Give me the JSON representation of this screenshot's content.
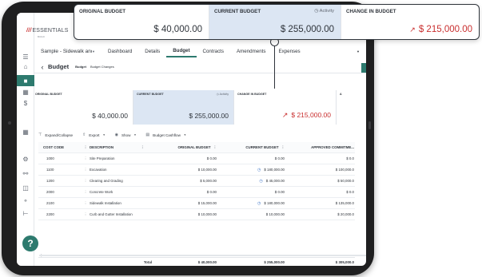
{
  "app": {
    "logo_text": "ESSENTIALS",
    "logo_sub": "BUILD"
  },
  "sidebar": {
    "icons": [
      "menu-icon",
      "home-icon",
      "dollar-active-icon",
      "grid-icon",
      "dollar-icon",
      "building-icon",
      "settings-icon",
      "users-icon",
      "folder-icon",
      "sitemap-icon",
      "hierarchy-icon"
    ],
    "help_label": "?"
  },
  "topnav": {
    "project": "Sample - Sidewalk and ...",
    "tabs": [
      "Dashboard",
      "Details",
      "Budget",
      "Contracts",
      "Amendments",
      "Expenses"
    ],
    "active_tab": "Budget"
  },
  "page": {
    "title": "Budget",
    "breadcrumb_bold": "Budget",
    "breadcrumb_rest": "Budget Changes"
  },
  "summary": {
    "original_label": "ORIGINAL BUDGET",
    "original_value": "$ 40,000.00",
    "current_label": "CURRENT BUDGET",
    "current_value": "$ 255,000.00",
    "activity_label": "Activity",
    "change_label": "CHANGE IN BUDGET",
    "change_value": "$ 215,000.00",
    "fourth_label": "A"
  },
  "toolbar": {
    "expand_label": "Expand/Collapse",
    "export_label": "Export",
    "show_label": "Show",
    "cashflow_label": "Budget Cashflow"
  },
  "table": {
    "headers": {
      "code": "COST CODE",
      "description": "DESCRIPTION",
      "original": "ORIGINAL BUDGET",
      "current": "CURRENT BUDGET",
      "approved": "APPROVED COMMITME..."
    },
    "rows": [
      {
        "code": "1000",
        "description": "Site Preparation",
        "original": "$ 0.00",
        "current": "$ 0.00",
        "current_clock": false,
        "approved": "$ 0.0"
      },
      {
        "code": "1100",
        "description": "Excavation",
        "original": "$ 10,000.00",
        "current": "$ 180,000.00",
        "current_clock": true,
        "approved": "$ 100,000.0"
      },
      {
        "code": "1200",
        "description": "Clearing and Grading",
        "original": "$ 5,000.00",
        "current": "$ 45,000.00",
        "current_clock": true,
        "approved": "$ 50,000.0"
      },
      {
        "code": "2000",
        "description": "Concrete Work",
        "original": "$ 0.00",
        "current": "$ 0.00",
        "current_clock": false,
        "approved": "$ 0.0"
      },
      {
        "code": "2100",
        "description": "Sidewalk Installation",
        "original": "$ 15,000.00",
        "current": "$ 180,000.00",
        "current_clock": true,
        "approved": "$ 135,000.0"
      },
      {
        "code": "2200",
        "description": "Curb and Gutter Installation",
        "original": "$ 10,000.00",
        "current": "$ 10,000.00",
        "current_clock": false,
        "approved": "$ 20,000.0"
      }
    ],
    "totals": {
      "label": "Total",
      "original": "$ 40,000.00",
      "current": "$ 255,000.00",
      "approved": "$ 305,000.0"
    }
  },
  "colors": {
    "accent": "#2d7a6e",
    "negative": "#c92f2f",
    "highlight": "#dce6f3",
    "clock": "#3a72c6"
  }
}
